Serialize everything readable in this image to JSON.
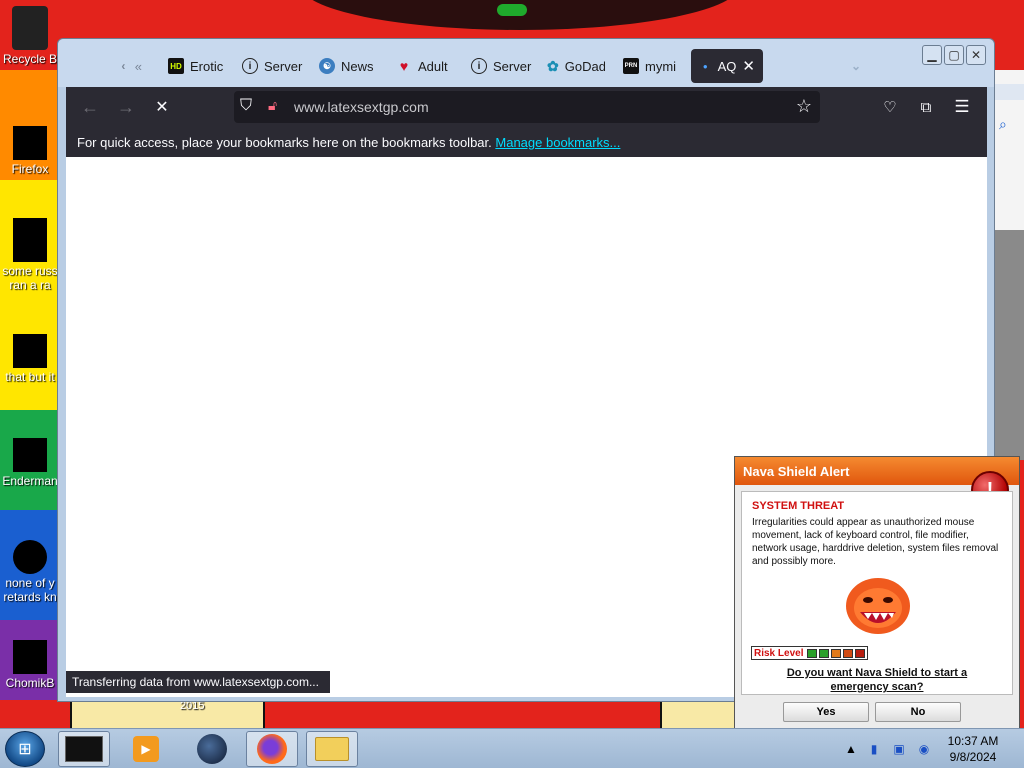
{
  "desktop": {
    "icons": [
      {
        "label": "Recycle B"
      },
      {
        "label": "Firefox"
      },
      {
        "label": "some russ"
      },
      {
        "label": "ran a ra"
      },
      {
        "label": "that but it"
      },
      {
        "label": "Enderman"
      },
      {
        "label": "none of y"
      },
      {
        "label": "retards kn"
      },
      {
        "label": "ChomikB"
      }
    ],
    "wallpaper_number": "2015",
    "wallpaper_colors": {
      "red": "#e3231c",
      "orange": "#ff8a00",
      "yellow": "#ffe600",
      "green": "#19a84a",
      "blue": "#1a5fd0",
      "purple": "#7a2fa8"
    }
  },
  "browser": {
    "tabs": [
      {
        "label": "«",
        "icon": "chevron-icon"
      },
      {
        "label": "Erotic",
        "icon": "hd-icon"
      },
      {
        "label": "Server",
        "icon": "info-icon"
      },
      {
        "label": "News",
        "icon": "news-icon"
      },
      {
        "label": "Adult",
        "icon": "lips-icon"
      },
      {
        "label": "Server",
        "icon": "info-icon"
      },
      {
        "label": "GoDad",
        "icon": "godaddy-icon"
      },
      {
        "label": "mymi",
        "icon": "porn-icon"
      },
      {
        "label": "AQ",
        "icon": "dot-icon",
        "active": true
      }
    ],
    "url": "www.latexsextgp.com",
    "bookmarks_bar": {
      "text": "For quick access, place your bookmarks here on the bookmarks toolbar.",
      "link": "Manage bookmarks..."
    },
    "status": "Transferring data from www.latexsextgp.com...",
    "accent": "#00ddff",
    "theme_color": "#2b2a33"
  },
  "alert": {
    "title": "Nava Shield Alert",
    "threat_title": "SYSTEM THREAT",
    "threat_desc": "Irregularities could appear as unauthorized mouse movement, lack of keyboard control, file modifier, network usage, harddrive deletion, system files removal and possibly more.",
    "risk_label": "Risk Level",
    "risk_colors": [
      "#2aa02a",
      "#2aa02a",
      "#e07a1a",
      "#d04a12",
      "#b81e10"
    ],
    "question": "Do you want Nava Shield to start a emergency scan?",
    "yes_label": "Yes",
    "no_label": "No",
    "header_color": "#f07020"
  },
  "taskbar": {
    "time": "10:37 AM",
    "date": "9/8/2024",
    "items": [
      "terminal-icon",
      "media-player-icon",
      "globe-icon",
      "firefox-icon",
      "explorer-icon"
    ]
  }
}
